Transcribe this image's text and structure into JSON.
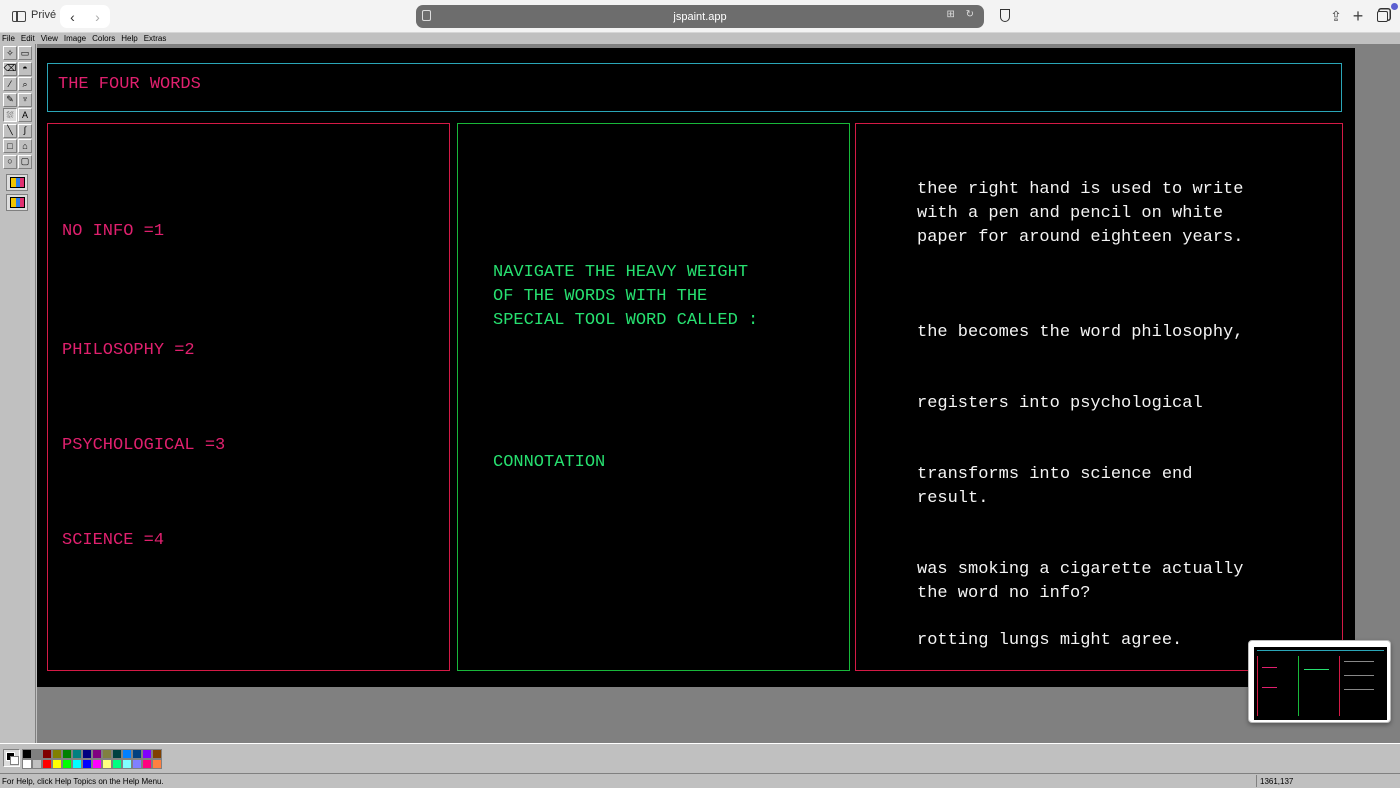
{
  "browser": {
    "private_label": "Privé",
    "url": "jspaint.app",
    "back_glyph": "‹",
    "forward_glyph": "›",
    "share_glyph": "⇪",
    "plus_glyph": "+",
    "url_right_glyphs": "⊞ ↻"
  },
  "menu": [
    "File",
    "Edit",
    "View",
    "Image",
    "Colors",
    "Help",
    "Extras"
  ],
  "tools": [
    {
      "icon": "free-select-icon",
      "glyph": "✧"
    },
    {
      "icon": "rect-select-icon",
      "glyph": "▭"
    },
    {
      "icon": "eraser-icon",
      "glyph": "⌫"
    },
    {
      "icon": "fill-bucket-icon",
      "glyph": "◓"
    },
    {
      "icon": "color-picker-icon",
      "glyph": "⁄"
    },
    {
      "icon": "magnifier-icon",
      "glyph": "⌕"
    },
    {
      "icon": "pencil-icon",
      "glyph": "✎"
    },
    {
      "icon": "brush-icon",
      "glyph": "♆"
    },
    {
      "icon": "airbrush-icon",
      "glyph": "⛆"
    },
    {
      "icon": "text-icon",
      "glyph": "A"
    },
    {
      "icon": "line-icon",
      "glyph": "╲"
    },
    {
      "icon": "curve-icon",
      "glyph": "∫"
    },
    {
      "icon": "rectangle-icon",
      "glyph": "□"
    },
    {
      "icon": "polygon-icon",
      "glyph": "⌂"
    },
    {
      "icon": "ellipse-icon",
      "glyph": "○"
    },
    {
      "icon": "rounded-rect-icon",
      "glyph": "▢"
    }
  ],
  "canvas": {
    "title": "THE FOUR WORDS",
    "left_items": [
      "NO INFO =1",
      "PHILOSOPHY =2",
      "PSYCHOLOGICAL =3",
      "SCIENCE =4"
    ],
    "middle_heading": "NAVIGATE THE HEAVY WEIGHT\nOF THE WORDS WITH THE\nSPECIAL TOOL WORD CALLED :",
    "middle_word": "CONNOTATION",
    "right_paragraphs": [
      "thee right hand is used to write\nwith a pen and pencil on white\npaper for around eighteen years.",
      "the becomes the word philosophy,",
      "registers into psychological",
      "transforms into science end\nresult.",
      "was smoking a cigarette actually\nthe word no info?",
      "rotting lungs might agree."
    ]
  },
  "colors": {
    "title_border": "#2aa6b8",
    "pink_text": "#e0206e",
    "green_text": "#27e070",
    "white_text": "#f4f4f4"
  },
  "palette": [
    "#000000",
    "#808080",
    "#800000",
    "#808000",
    "#008000",
    "#008080",
    "#000080",
    "#800080",
    "#808040",
    "#004040",
    "#0080ff",
    "#004080",
    "#8000ff",
    "#804000",
    "#ffffff",
    "#c0c0c0",
    "#ff0000",
    "#ffff00",
    "#00ff00",
    "#00ffff",
    "#0000ff",
    "#ff00ff",
    "#ffff80",
    "#00ff80",
    "#80ffff",
    "#8080ff",
    "#ff0080",
    "#ff8040"
  ],
  "status": {
    "help_text": "For Help, click Help Topics on the Help Menu.",
    "coordinates": "1361,137"
  }
}
